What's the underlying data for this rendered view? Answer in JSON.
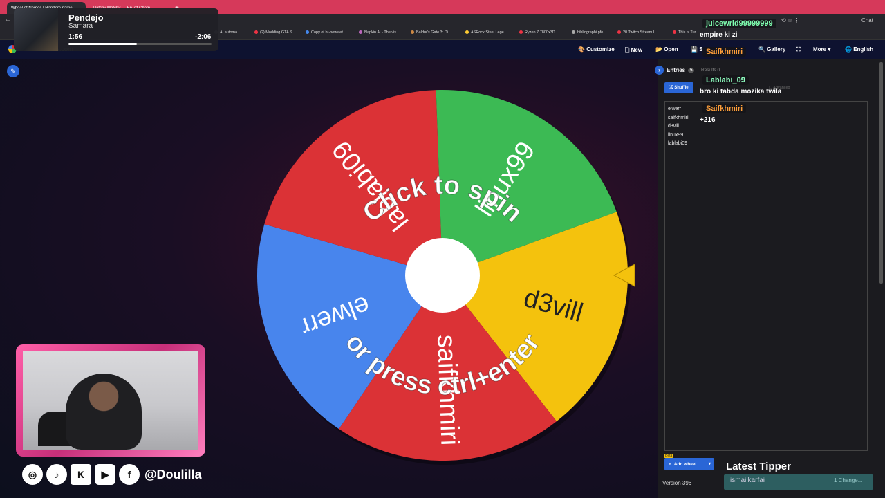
{
  "browser": {
    "active_tab": "Wheel of Names | Random name",
    "tab2": "Matchy Matchy — Ep 7ft Chem",
    "new_tab": "+",
    "back": "←",
    "bookmarks": [
      "AI automa...",
      "(2) Modding GTA S...",
      "Copy of hr-newslet...",
      "Napkin AI - The vis...",
      "Baldur's Gate 3: Di...",
      "ASRock Steel Lege...",
      "Ryzen 7 7800x3D...",
      "bibliographi pfe",
      "20 Twitch Stream I...",
      "This is Tur..."
    ],
    "chat_ext": "Chat"
  },
  "app": {
    "name": "wheelofnames.com",
    "toolbar": {
      "customize": "Customize",
      "new": "New",
      "open": "Open",
      "save": "S",
      "gallery": "Gallery",
      "fullscreen": "⛶",
      "more": "More",
      "language": "English"
    }
  },
  "wheel": {
    "prompt_top": "Click to spin",
    "prompt_bottom": "or press ctrl+enter",
    "pointer_color": "#f4c20d",
    "slices": [
      {
        "label": "d3vill",
        "color": "#f4c20d"
      },
      {
        "label": "saifkhmiri",
        "color": "#db3236"
      },
      {
        "label": "elwerr",
        "color": "#4885ed"
      },
      {
        "label": "lablabi09",
        "color": "#db3236"
      },
      {
        "label": "linux99",
        "color": "#3cba54"
      }
    ]
  },
  "panel": {
    "entries_label": "Entries",
    "entries_count": "5",
    "results_label": "Results",
    "results_count": "0",
    "shuffle": "Shuffle",
    "advanced": "Advanced",
    "entries": [
      "elwerr",
      "saifkhmiri",
      "d3vill",
      "linux99",
      "lablabi09"
    ],
    "add_wheel": "Add wheel",
    "beta": "Beta",
    "version": "Version 396"
  },
  "media": {
    "title": "Pendejo",
    "artist": "Samara",
    "elapsed": "1:56",
    "remaining": "-2:06",
    "progress": 0.48
  },
  "chat": [
    {
      "user": "juicewrld99999999",
      "color": "#7fffb0",
      "message": "empire ki zi"
    },
    {
      "user": "Saifkhmiri",
      "color": "#ff9f3a",
      "message": ""
    },
    {
      "user": "Lablabi_09",
      "color": "#8fffc0",
      "message": "bro ki tabda mozika twila"
    },
    {
      "user": "Saifkhmiri",
      "color": "#ff9f3a",
      "message": "+216"
    }
  ],
  "overlay": {
    "handle": "@Doulilla",
    "social_icons": [
      "instagram-icon",
      "tiktok-icon",
      "kick-icon",
      "youtube-icon",
      "facebook-icon"
    ],
    "tipper_title": "Latest Tipper",
    "tipper_name": "ismailkarfai",
    "tipper_amount": "1 Change..."
  }
}
